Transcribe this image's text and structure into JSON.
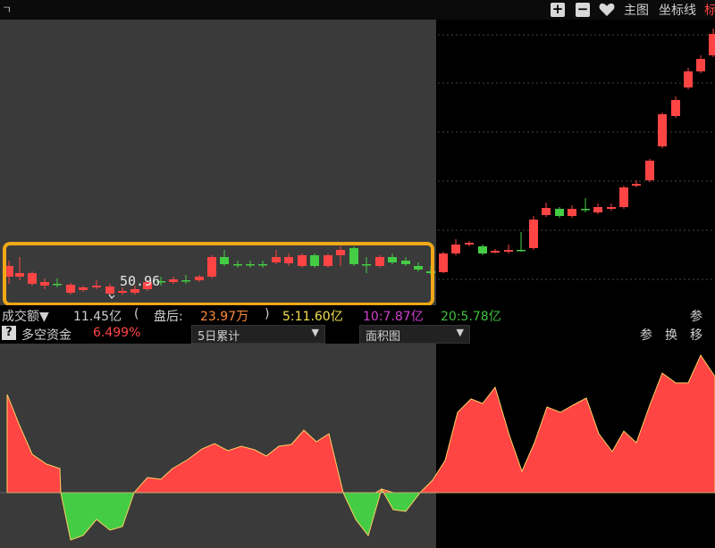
{
  "topbar": {
    "corner_mark": "ㄱ",
    "plus": "+",
    "minus": "−",
    "main_chart": "主图",
    "coord_line": "坐标线",
    "right_cut": "标"
  },
  "main_chart": {
    "price_label": "50.96"
  },
  "volume_bar": {
    "title": "成交额▼",
    "value": "11.45亿",
    "paren_open": "(",
    "after_hours_label": "盘后:",
    "after_hours_value": "23.97万",
    "paren_close": ")",
    "ma5": "5:11.60亿",
    "ma10": "10:7.87亿",
    "ma20": "20:5.78亿",
    "param": "参"
  },
  "indicator_bar": {
    "help": "?",
    "name": "多空资金",
    "value": "6.499%",
    "period_select": "5日累计",
    "chart_type_select": "面积图",
    "param": "参",
    "swap": "换",
    "move": "移"
  },
  "colors": {
    "up": "#ff4444",
    "down": "#44cc44",
    "highlight": "#f0a818",
    "left_panel": "#3a3a3a",
    "volume_value": "#d0d0d0",
    "after_hours": "#ff8c3c",
    "ma5": "#f0e050",
    "ma10": "#d040d0",
    "ma20": "#40c040",
    "ind_value": "#ff4444"
  },
  "icons": {
    "heart": "heart-icon",
    "dropdown": "triangle-down-icon"
  }
}
